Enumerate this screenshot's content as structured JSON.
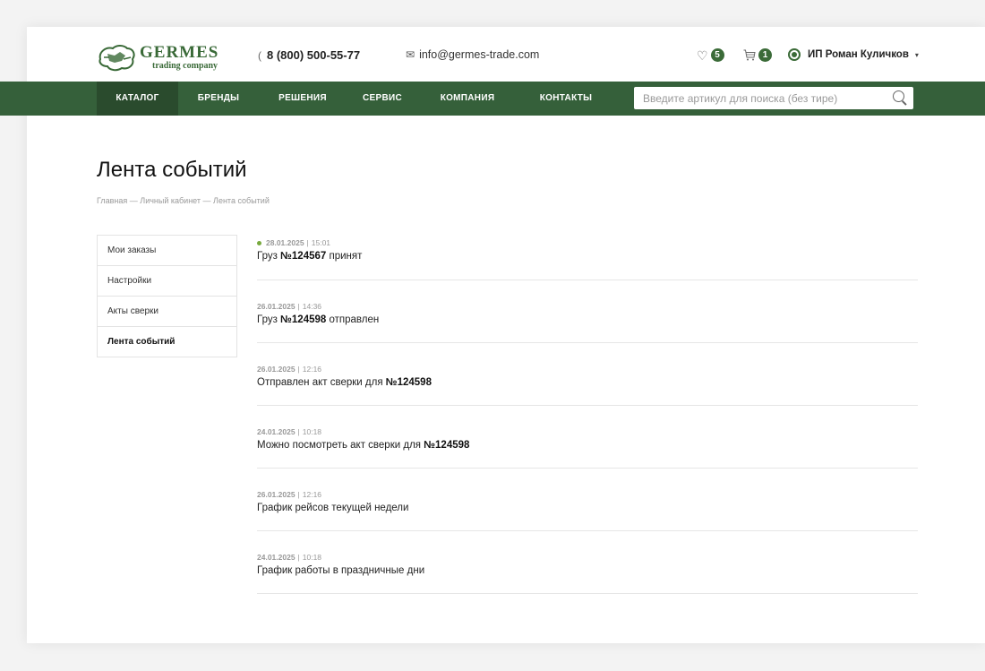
{
  "header": {
    "logo": {
      "name": "GERMES",
      "tagline": "trading company"
    },
    "phone": "8 (800) 500-55-77",
    "email": "info@germes-trade.com",
    "favorites_count": "5",
    "cart_count": "1",
    "user_name": "ИП Роман Куличков"
  },
  "nav": {
    "items": [
      {
        "label": "КАТАЛОГ"
      },
      {
        "label": "БРЕНДЫ"
      },
      {
        "label": "РЕШЕНИЯ"
      },
      {
        "label": "СЕРВИС"
      },
      {
        "label": "КОМПАНИЯ"
      },
      {
        "label": "КОНТАКТЫ"
      }
    ],
    "search_placeholder": "Введите артикул для поиска (без тире)"
  },
  "page": {
    "title": "Лента событий",
    "breadcrumb": [
      "Главная",
      "Личный кабинет",
      "Лента событий"
    ],
    "breadcrumb_sep": "—"
  },
  "sidebar": {
    "items": [
      {
        "label": "Мои заказы"
      },
      {
        "label": "Настройки"
      },
      {
        "label": "Акты сверки"
      },
      {
        "label": "Лента событий"
      }
    ]
  },
  "events": [
    {
      "date": "28.01.2025",
      "time": "15:01",
      "pre": "Груз ",
      "num": "№124567",
      "post": " принят",
      "new": true
    },
    {
      "date": "26.01.2025",
      "time": "14:36",
      "pre": "Груз ",
      "num": "№124598",
      "post": " отправлен",
      "new": false
    },
    {
      "date": "26.01.2025",
      "time": "12:16",
      "pre": "Отправлен акт сверки для ",
      "num": "№124598",
      "post": "",
      "new": false
    },
    {
      "date": "24.01.2025",
      "time": "10:18",
      "pre": "Можно посмотреть акт сверки для ",
      "num": "№124598",
      "post": "",
      "new": false
    },
    {
      "date": "26.01.2025",
      "time": "12:16",
      "pre": "График рейсов текущей недели",
      "num": "",
      "post": "",
      "new": false
    },
    {
      "date": "24.01.2025",
      "time": "10:18",
      "pre": "График работы в праздничные дни",
      "num": "",
      "post": "",
      "new": false
    }
  ],
  "colors": {
    "brand": "#35603a",
    "accent_dot": "#77a93d"
  },
  "icons": [
    "phone-icon",
    "mail-icon",
    "heart-icon",
    "cart-icon",
    "user-icon",
    "search-icon"
  ]
}
